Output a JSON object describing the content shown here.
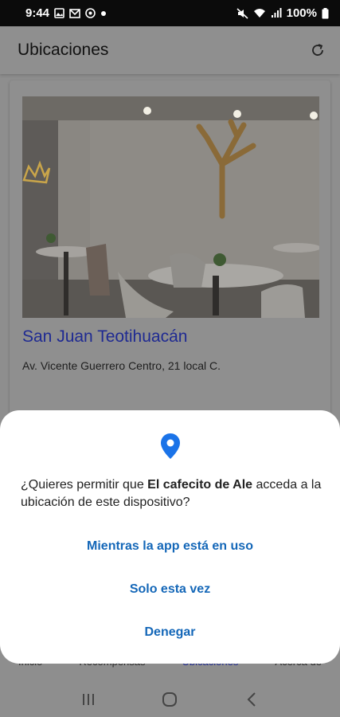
{
  "status": {
    "time": "9:44",
    "battery": "100%",
    "left_icons": [
      "image-icon",
      "mail-icon",
      "circle-app-icon",
      "dot-icon"
    ],
    "right_icons": [
      "mute-icon",
      "wifi-icon",
      "signal-icon",
      "battery-icon"
    ]
  },
  "app_bar": {
    "title": "Ubicaciones",
    "refresh_icon": "refresh-icon"
  },
  "location": {
    "name": "San Juan Teotihuacán",
    "address": "Av. Vicente Guerrero Centro, 21 local C."
  },
  "bottom_nav": {
    "items": [
      "Inicio",
      "Recompensas",
      "Ubicaciones",
      "Acerca de"
    ],
    "active": "Ubicaciones"
  },
  "dialog": {
    "question_prefix": "¿Quieres permitir que ",
    "app_name": "El cafecito de Ale",
    "question_suffix": " acceda a la ubicación de este dispositivo?",
    "option_1": "Mientras la app está en uso",
    "option_2": "Solo esta vez",
    "option_3": "Denegar"
  },
  "colors": {
    "accent": "#1467b8",
    "location_title": "#1f2a92",
    "pin": "#1a73e8"
  }
}
